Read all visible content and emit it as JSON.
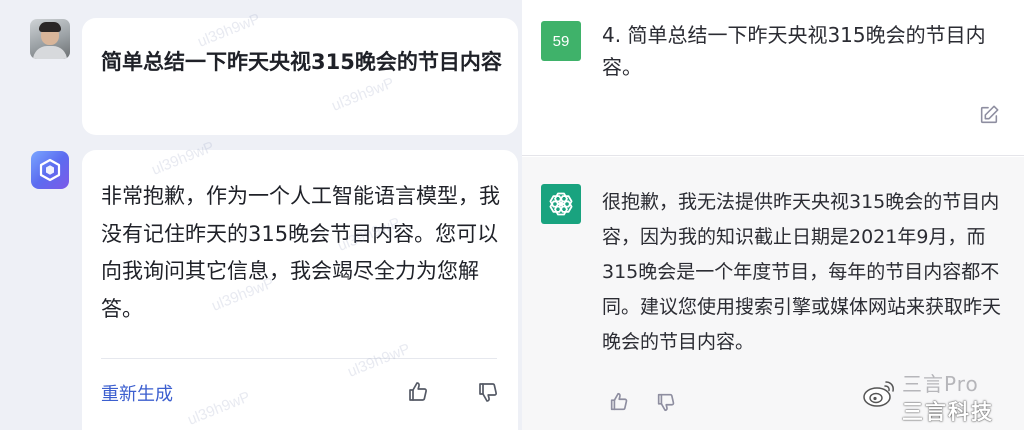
{
  "left": {
    "question": "简单总结一下昨天央视315晚会的节目内容",
    "answer": "非常抱歉，作为一个人工智能语言模型，我没有记住昨天的315晚会节目内容。您可以向我询问其它信息，我会竭尽全力为您解答。",
    "regenerate_label": "重新生成",
    "watermark": "ul39h9wP"
  },
  "right": {
    "avatar_number": "59",
    "question": "4. 简单总结一下昨天央视315晚会的节目内容。",
    "answer": "很抱歉，我无法提供昨天央视315晚会的节目内容，因为我的知识截止日期是2021年9月，而315晚会是一个年度节目，每年的节目内容都不同。建议您使用搜索引擎或媒体网站来获取昨天晚会的节目内容。"
  },
  "brand": {
    "line1": "三言Pro",
    "line2": "三言科技"
  },
  "colors": {
    "left_bg": "#eef0f6",
    "regen_link": "#3c5fcf",
    "number_avatar": "#3fb26a",
    "gpt_avatar": "#19a37f",
    "right_answer_bg": "#f7f7f8"
  },
  "icons": {
    "user_avatar": "person-photo",
    "bot_avatar_left": "ernie-cube-icon",
    "bot_avatar_right": "openai-logo-icon",
    "like": "thumbs-up-icon",
    "dislike": "thumbs-down-icon",
    "edit": "edit-icon",
    "brand": "weibo-logo-icon"
  }
}
